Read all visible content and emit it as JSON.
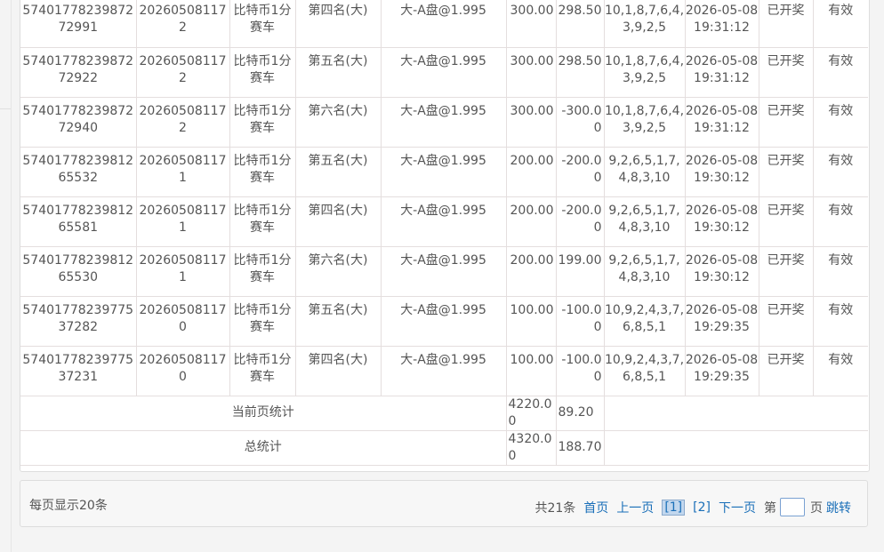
{
  "rows": [
    {
      "id": "5740177823987272991",
      "issue": "202605081172",
      "game": "比特币1分赛车",
      "play": "第四名(大)",
      "odds": "大-A盘@1.995",
      "amount": "300.00",
      "win": "298.50",
      "result": "10,1,8,7,6,4,3,9,2,5",
      "time": "2026-05-08 19:31:12",
      "state": "已开奖",
      "valid": "有效"
    },
    {
      "id": "5740177823987272922",
      "issue": "202605081172",
      "game": "比特币1分赛车",
      "play": "第五名(大)",
      "odds": "大-A盘@1.995",
      "amount": "300.00",
      "win": "298.50",
      "result": "10,1,8,7,6,4,3,9,2,5",
      "time": "2026-05-08 19:31:12",
      "state": "已开奖",
      "valid": "有效"
    },
    {
      "id": "5740177823987272940",
      "issue": "202605081172",
      "game": "比特币1分赛车",
      "play": "第六名(大)",
      "odds": "大-A盘@1.995",
      "amount": "300.00",
      "win": "-300.00",
      "result": "10,1,8,7,6,4,3,9,2,5",
      "time": "2026-05-08 19:31:12",
      "state": "已开奖",
      "valid": "有效"
    },
    {
      "id": "5740177823981265532",
      "issue": "202605081171",
      "game": "比特币1分赛车",
      "play": "第五名(大)",
      "odds": "大-A盘@1.995",
      "amount": "200.00",
      "win": "-200.00",
      "result": "9,2,6,5,1,7,4,8,3,10",
      "time": "2026-05-08 19:30:12",
      "state": "已开奖",
      "valid": "有效"
    },
    {
      "id": "5740177823981265581",
      "issue": "202605081171",
      "game": "比特币1分赛车",
      "play": "第四名(大)",
      "odds": "大-A盘@1.995",
      "amount": "200.00",
      "win": "-200.00",
      "result": "9,2,6,5,1,7,4,8,3,10",
      "time": "2026-05-08 19:30:12",
      "state": "已开奖",
      "valid": "有效"
    },
    {
      "id": "5740177823981265530",
      "issue": "202605081171",
      "game": "比特币1分赛车",
      "play": "第六名(大)",
      "odds": "大-A盘@1.995",
      "amount": "200.00",
      "win": "199.00",
      "result": "9,2,6,5,1,7,4,8,3,10",
      "time": "2026-05-08 19:30:12",
      "state": "已开奖",
      "valid": "有效"
    },
    {
      "id": "5740177823977537282",
      "issue": "202605081170",
      "game": "比特币1分赛车",
      "play": "第五名(大)",
      "odds": "大-A盘@1.995",
      "amount": "100.00",
      "win": "-100.00",
      "result": "10,9,2,4,3,7,6,8,5,1",
      "time": "2026-05-08 19:29:35",
      "state": "已开奖",
      "valid": "有效"
    },
    {
      "id": "5740177823977537231",
      "issue": "202605081170",
      "game": "比特币1分赛车",
      "play": "第四名(大)",
      "odds": "大-A盘@1.995",
      "amount": "100.00",
      "win": "-100.00",
      "result": "10,9,2,4,3,7,6,8,5,1",
      "time": "2026-05-08 19:29:35",
      "state": "已开奖",
      "valid": "有效"
    }
  ],
  "summary": {
    "page_label": "当前页统计",
    "page_amount": "4220.00",
    "page_win": "89.20",
    "total_label": "总统计",
    "total_amount": "4320.00",
    "total_win": "188.70"
  },
  "footer": {
    "per_page": "每页显示20条",
    "total": "共21条",
    "first": "首页",
    "prev": "上一页",
    "page1": "[1]",
    "page2": "[2]",
    "next": "下一页",
    "goto_prefix": "第",
    "goto_suffix": "页",
    "jump": "跳转"
  }
}
